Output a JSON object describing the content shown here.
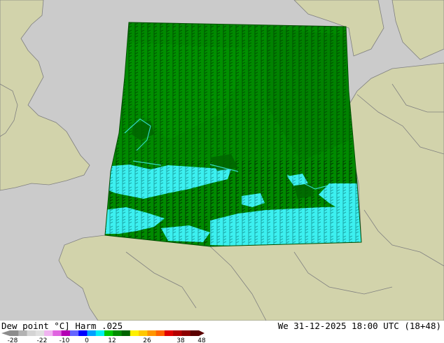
{
  "header": {
    "title": "Dew point °C] Harm .025",
    "datetime": "We 31-12-2025 18:00 UTC (18+48)"
  },
  "colors": {
    "sea": "#cbcbcb",
    "land": "#d2d3ab",
    "field_green": "#008a00",
    "field_dark_green": "#006400",
    "field_cyan": "#3cf0f0",
    "coastline": "#808080"
  },
  "legend": {
    "tick_labels": [
      "-28",
      "-22",
      "-10",
      "0",
      "12",
      "26",
      "38",
      "48"
    ],
    "colors": [
      "#8c8c8c",
      "#b3b3b3",
      "#d4d4d4",
      "#e0e0e0",
      "#f0b4f0",
      "#e064e0",
      "#b400b4",
      "#6464ff",
      "#0000ff",
      "#00a0ff",
      "#00f0f0",
      "#00c800",
      "#008c00",
      "#006400",
      "#fff000",
      "#ffc800",
      "#ff9600",
      "#ff6400",
      "#e00000",
      "#b40000",
      "#8c0000",
      "#5a0000"
    ]
  }
}
